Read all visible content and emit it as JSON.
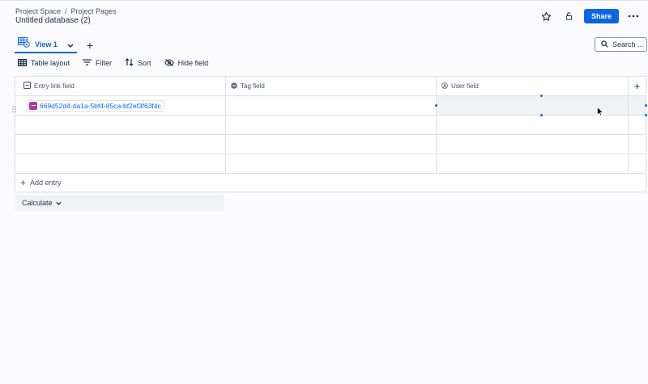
{
  "breadcrumb": {
    "space": "Project Space",
    "separator": "/",
    "page": "Project Pages"
  },
  "page_title": "Untitled database (2)",
  "header_actions": {
    "share_label": "Share"
  },
  "view": {
    "tab_label": "View 1",
    "add_view": "+"
  },
  "search": {
    "label": "Search ..."
  },
  "toolbar": {
    "layout": "Table layout",
    "filter": "Filter",
    "sort": "Sort",
    "hide": "Hide field"
  },
  "table": {
    "columns": [
      {
        "label": "Entry link field",
        "icon": "entry-link-icon"
      },
      {
        "label": "Tag field",
        "icon": "tag-icon"
      },
      {
        "label": "User field",
        "icon": "user-icon"
      }
    ],
    "add_column": "+",
    "rows": [
      {
        "entry": "669d52d4-4a1a-5bf4-85ca-bf2ef3f63f4c",
        "tag": "",
        "user": ""
      },
      {
        "entry": "",
        "tag": "",
        "user": ""
      },
      {
        "entry": "",
        "tag": "",
        "user": ""
      },
      {
        "entry": "",
        "tag": "",
        "user": ""
      }
    ],
    "add_entry": "Add entry"
  },
  "calculate": {
    "label": "Calculate"
  },
  "colors": {
    "accent": "#0c66e4",
    "entry_chip": "#b03aa0",
    "border": "#dcdfe4"
  }
}
